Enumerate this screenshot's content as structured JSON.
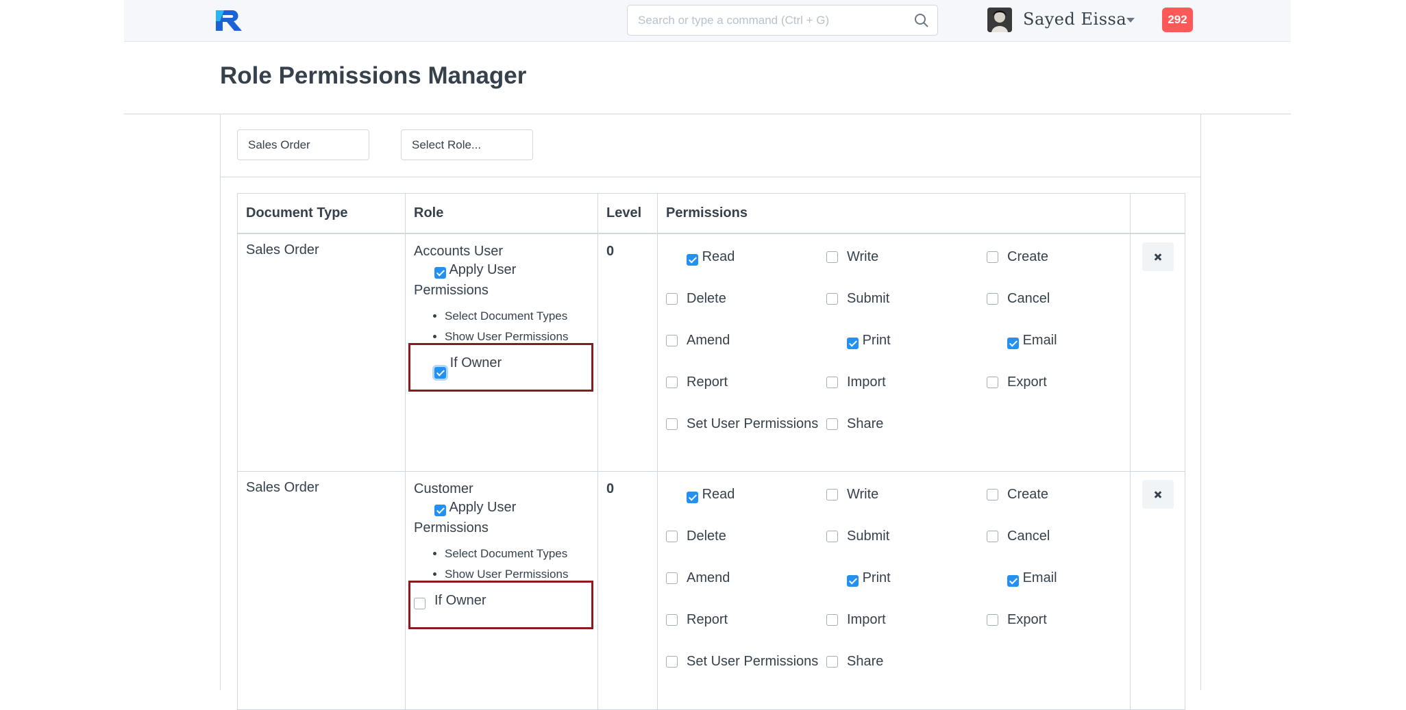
{
  "navbar": {
    "search_placeholder": "Search or type a command (Ctrl + G)",
    "user_name": "Sayed  Eissa",
    "notification_count": "292",
    "logo_colors": [
      "#1a62d6",
      "#29b6f6"
    ]
  },
  "page": {
    "title": "Role Permissions Manager"
  },
  "filters": {
    "document_type": "Sales Order",
    "role": "Select Role..."
  },
  "table": {
    "headers": [
      "Document Type",
      "Role",
      "Level",
      "Permissions"
    ],
    "rows": [
      {
        "document_type": "Sales Order",
        "role": "Accounts User",
        "apply_user_permissions": "Apply User Permissions",
        "links": [
          "Select Document Types",
          "Show User Permissions"
        ],
        "if_owner": "If Owner",
        "if_owner_checked": true,
        "level": "0",
        "permissions": [
          {
            "label": "Read",
            "checked": true
          },
          {
            "label": "Write",
            "checked": false
          },
          {
            "label": "Create",
            "checked": false
          },
          {
            "label": "Delete",
            "checked": false
          },
          {
            "label": "Submit",
            "checked": false
          },
          {
            "label": "Cancel",
            "checked": false
          },
          {
            "label": "Amend",
            "checked": false
          },
          {
            "label": "Print",
            "checked": true
          },
          {
            "label": "Email",
            "checked": true
          },
          {
            "label": "Report",
            "checked": false
          },
          {
            "label": "Import",
            "checked": false
          },
          {
            "label": "Export",
            "checked": false
          },
          {
            "label": "Set User Permissions",
            "checked": false
          },
          {
            "label": "Share",
            "checked": false
          }
        ]
      },
      {
        "document_type": "Sales Order",
        "role": "Customer",
        "apply_user_permissions": "Apply User Permissions",
        "links": [
          "Select Document Types",
          "Show User Permissions"
        ],
        "if_owner": "If Owner",
        "if_owner_checked": false,
        "level": "0",
        "permissions": [
          {
            "label": "Read",
            "checked": true
          },
          {
            "label": "Write",
            "checked": false
          },
          {
            "label": "Create",
            "checked": false
          },
          {
            "label": "Delete",
            "checked": false
          },
          {
            "label": "Submit",
            "checked": false
          },
          {
            "label": "Cancel",
            "checked": false
          },
          {
            "label": "Amend",
            "checked": false
          },
          {
            "label": "Print",
            "checked": true
          },
          {
            "label": "Email",
            "checked": true
          },
          {
            "label": "Report",
            "checked": false
          },
          {
            "label": "Import",
            "checked": false
          },
          {
            "label": "Export",
            "checked": false
          },
          {
            "label": "Set User Permissions",
            "checked": false
          },
          {
            "label": "Share",
            "checked": false
          }
        ]
      }
    ]
  },
  "colors": {
    "checkbox_on": "#2490ef",
    "highlight_box": "#8b1a1a",
    "notification": "#ff5858"
  }
}
